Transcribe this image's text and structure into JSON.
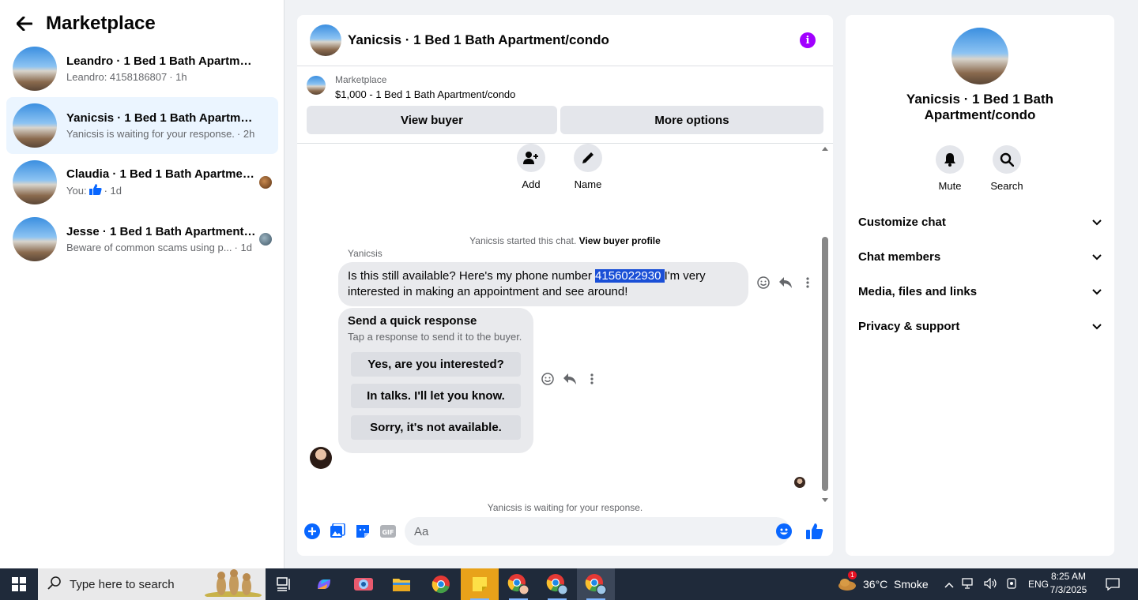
{
  "sidebar": {
    "title": "Marketplace",
    "conversations": [
      {
        "name": "Leandro · 1 Bed 1 Bath Apartment/...",
        "preview": "Leandro: 4158186807",
        "time": "· 1h"
      },
      {
        "name": "Yanicsis · 1 Bed 1 Bath Apartment/...",
        "preview": "Yanicsis is waiting for your response.",
        "time": "· 2h"
      },
      {
        "name": "Claudia · 1 Bed 1 Bath Apartmen...",
        "preview": "You:",
        "time": "· 1d"
      },
      {
        "name": "Jesse · 1 Bed 1 Bath Apartment/c...",
        "preview": "Beware of common scams using p...",
        "time": "· 1d"
      }
    ]
  },
  "chat": {
    "title": "Yanicsis · 1 Bed 1 Bath Apartment/condo",
    "listing": {
      "source": "Marketplace",
      "price_title": "$1,000 - 1 Bed 1 Bath Apartment/condo"
    },
    "view_buyer": "View buyer",
    "more_options": "More options",
    "actions": {
      "add": "Add",
      "name": "Name"
    },
    "started_text": "Yanicsis started this chat.",
    "view_profile": "View buyer profile",
    "sender": "Yanicsis",
    "message": {
      "before": "Is this still available? Here's my phone number ",
      "highlight": "4156022930 ",
      "after": "I'm very interested in making an appointment and see around!"
    },
    "quick": {
      "title": "Send a quick response",
      "subtitle": "Tap a response to send it to the buyer.",
      "options": [
        "Yes, are you interested?",
        "In talks. I'll let you know.",
        "Sorry, it's not available."
      ]
    },
    "waiting": "Yanicsis is waiting for your response.",
    "composer_placeholder": "Aa"
  },
  "info": {
    "name": "Yanicsis · 1 Bed 1 Bath Apartment/condo",
    "mute": "Mute",
    "search": "Search",
    "sections": [
      "Customize chat",
      "Chat members",
      "Media, files and links",
      "Privacy & support"
    ]
  },
  "taskbar": {
    "search_placeholder": "Type here to search",
    "weather": "36°C  Smoke",
    "lang": "ENG",
    "time": "8:25 AM",
    "date": "7/3/2025",
    "weather_badge": "1"
  },
  "colors": {
    "accent": "#0866ff",
    "info": "#a100ff",
    "active": "#ebf5ff"
  }
}
